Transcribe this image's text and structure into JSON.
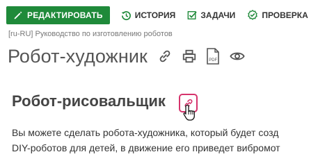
{
  "toolbar": {
    "edit_label": "РЕДАКТИРОВАТЬ",
    "history_label": "ИСТОРИЯ",
    "tasks_label": "ЗАДАЧИ",
    "check_label": "ПРОВЕРКА",
    "accent_color": "#1f8a3a"
  },
  "breadcrumb": "[ru-RU] Руководство по изготовлению роботов",
  "page": {
    "title": "Робот-художник",
    "icons": [
      "link-icon",
      "print-icon",
      "pdf-icon",
      "eye-icon"
    ],
    "pdf_icon_text": "PDF"
  },
  "section": {
    "heading": "Робот-рисовальщик",
    "anchor_color": "#d6336c",
    "paragraph_lines": [
      "Вы можете сделать робота-художника, который будет созд",
      "DIY-роботов для детей, в движение его приведет вибромот"
    ]
  }
}
